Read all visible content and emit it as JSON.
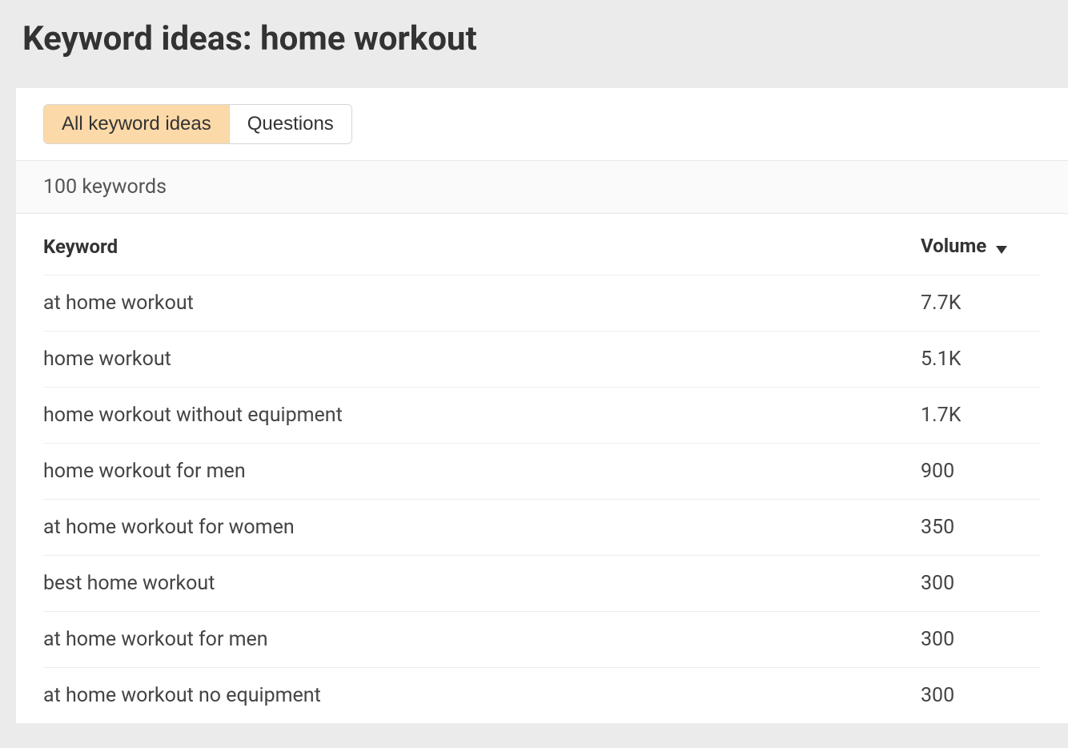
{
  "header": {
    "title": "Keyword ideas: home workout"
  },
  "tabs": [
    {
      "label": "All keyword ideas",
      "active": true
    },
    {
      "label": "Questions",
      "active": false
    }
  ],
  "count_label": "100 keywords",
  "table": {
    "columns": {
      "keyword": "Keyword",
      "volume": "Volume"
    },
    "sort_direction": "desc",
    "rows": [
      {
        "keyword": "at home workout",
        "volume": "7.7K"
      },
      {
        "keyword": "home workout",
        "volume": "5.1K"
      },
      {
        "keyword": "home workout without equipment",
        "volume": "1.7K"
      },
      {
        "keyword": "home workout for men",
        "volume": "900"
      },
      {
        "keyword": "at home workout for women",
        "volume": "350"
      },
      {
        "keyword": "best home workout",
        "volume": "300"
      },
      {
        "keyword": "at home workout for men",
        "volume": "300"
      },
      {
        "keyword": "at home workout no equipment",
        "volume": "300"
      }
    ]
  }
}
